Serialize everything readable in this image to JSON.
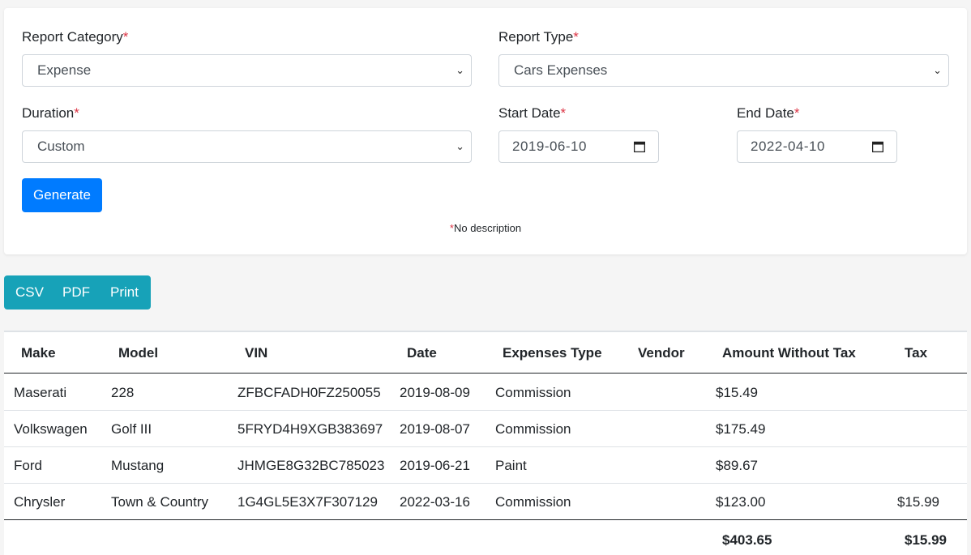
{
  "form": {
    "report_category": {
      "label": "Report Category",
      "value": "Expense"
    },
    "report_type": {
      "label": "Report Type",
      "value": "Cars Expenses"
    },
    "duration": {
      "label": "Duration",
      "value": "Custom"
    },
    "start_date": {
      "label": "Start Date",
      "value": "2019-06-10"
    },
    "end_date": {
      "label": "End Date",
      "value": "2022-04-10"
    },
    "required_mark": "*",
    "generate_label": "Generate",
    "note_mark": "*",
    "note_text": "No description"
  },
  "export": {
    "csv": "CSV",
    "pdf": "PDF",
    "print": "Print"
  },
  "table": {
    "headers": [
      "Make",
      "Model",
      "VIN",
      "Date",
      "Expenses Type",
      "Vendor",
      "Amount Without Tax",
      "Tax"
    ],
    "rows": [
      [
        "Maserati",
        "228",
        "ZFBCFADH0FZ250055",
        "2019-08-09",
        "Commission",
        "",
        "$15.49",
        ""
      ],
      [
        "Volkswagen",
        "Golf III",
        "5FRYD4H9XGB383697",
        "2019-08-07",
        "Commission",
        "",
        "$175.49",
        ""
      ],
      [
        "Ford",
        "Mustang",
        "JHMGE8G32BC785023",
        "2019-06-21",
        "Paint",
        "",
        "$89.67",
        ""
      ],
      [
        "Chrysler",
        "Town & Country",
        "1G4GL5E3X7F307129",
        "2022-03-16",
        "Commission",
        "",
        "$123.00",
        "$15.99"
      ]
    ],
    "totals": {
      "amount": "$403.65",
      "tax": "$15.99"
    }
  },
  "colors": {
    "primary": "#007bff",
    "info": "#17a2b8",
    "required": "#dc3545"
  }
}
